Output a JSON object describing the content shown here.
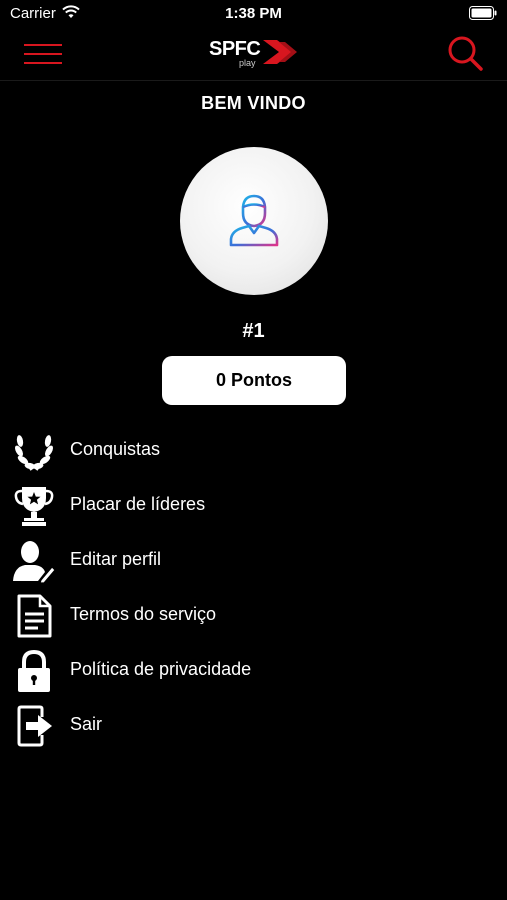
{
  "status_bar": {
    "carrier": "Carrier",
    "time": "1:38 PM"
  },
  "header": {
    "logo_text": "SPFC",
    "logo_sub": "play",
    "accent_color": "#d8161f"
  },
  "profile": {
    "welcome": "BEM VINDO",
    "rank": "#1",
    "points_label": "0 Pontos"
  },
  "menu": [
    {
      "label": "Conquistas",
      "icon": "laurel-wreath-icon"
    },
    {
      "label": "Placar de líderes",
      "icon": "trophy-icon"
    },
    {
      "label": "Editar perfil",
      "icon": "edit-profile-icon"
    },
    {
      "label": "Termos do serviço",
      "icon": "document-icon"
    },
    {
      "label": "Política de privacidade",
      "icon": "lock-icon"
    },
    {
      "label": "Sair",
      "icon": "logout-icon"
    }
  ]
}
